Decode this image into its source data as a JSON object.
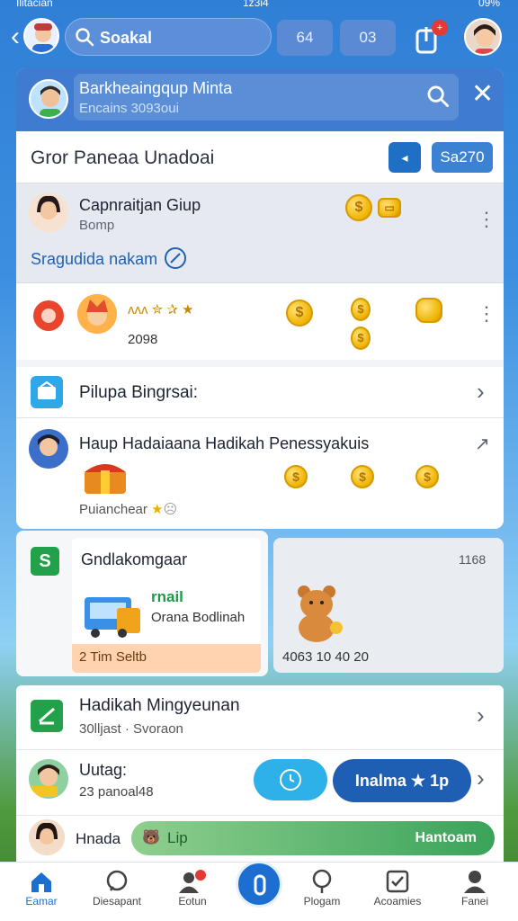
{
  "status_bar": {
    "carrier": "Ilitacian",
    "time": "1z3i4",
    "battery": "09%"
  },
  "top_bar": {
    "search_text": "Soakal",
    "chip_1": "64",
    "chip_2": "03",
    "notif_badge": "+"
  },
  "panel_header": {
    "title": "Barkheaingqup Minta",
    "subtitle": "Encains 3093oui"
  },
  "group_row": {
    "title": "Gror Paneaa Unadoai",
    "btn_a": "◂",
    "btn_b": "Sa270"
  },
  "campaign": {
    "title": "Capnraitjan Giup",
    "subtitle": "Bomp",
    "link": "Sragudida nakam"
  },
  "reward_row": {
    "stars": "ᴧᴧᴧ ✮ ✰ ★",
    "count": "2098"
  },
  "pilpa_row": {
    "label": "Pilupa Bingrsai:"
  },
  "haup_row": {
    "title": "Haup Hadaiaana Hadikah Penessyakuis",
    "footer": "Puianchear"
  },
  "card_left": {
    "icon_letter": "S",
    "title": "Gndlakomgaar",
    "mail_tag": "rnail",
    "mail_sub": "Orana Bodlinah",
    "footer": "2 Tim Seltb"
  },
  "card_right": {
    "count": "1168",
    "footer": "4063 10 40 20"
  },
  "hadikah_row": {
    "title": "Hadikah Mingyeunan",
    "subtitle": "30lljast · Svoraon"
  },
  "uutag_row": {
    "title": "Uutag:",
    "subtitle": "23 panoal48",
    "main_button": "Inalma ★ 1p"
  },
  "hnada_row": {
    "label": "Hnada",
    "bar_left": "Lip",
    "bar_right": "Hantoam"
  },
  "bottom_nav": [
    {
      "label": "Eamar",
      "icon": "home-icon"
    },
    {
      "label": "Diesapant",
      "icon": "chat-icon"
    },
    {
      "label": "Eotun",
      "icon": "people-icon"
    },
    {
      "label": "",
      "icon": "plus-icon"
    },
    {
      "label": "Plogam",
      "icon": "pin-icon"
    },
    {
      "label": "Acoamies",
      "icon": "check-icon"
    },
    {
      "label": "Fanei",
      "icon": "person-icon"
    }
  ],
  "colors": {
    "accent": "#1c6fd1",
    "header": "#3f7bd0",
    "green": "#23a04a"
  }
}
